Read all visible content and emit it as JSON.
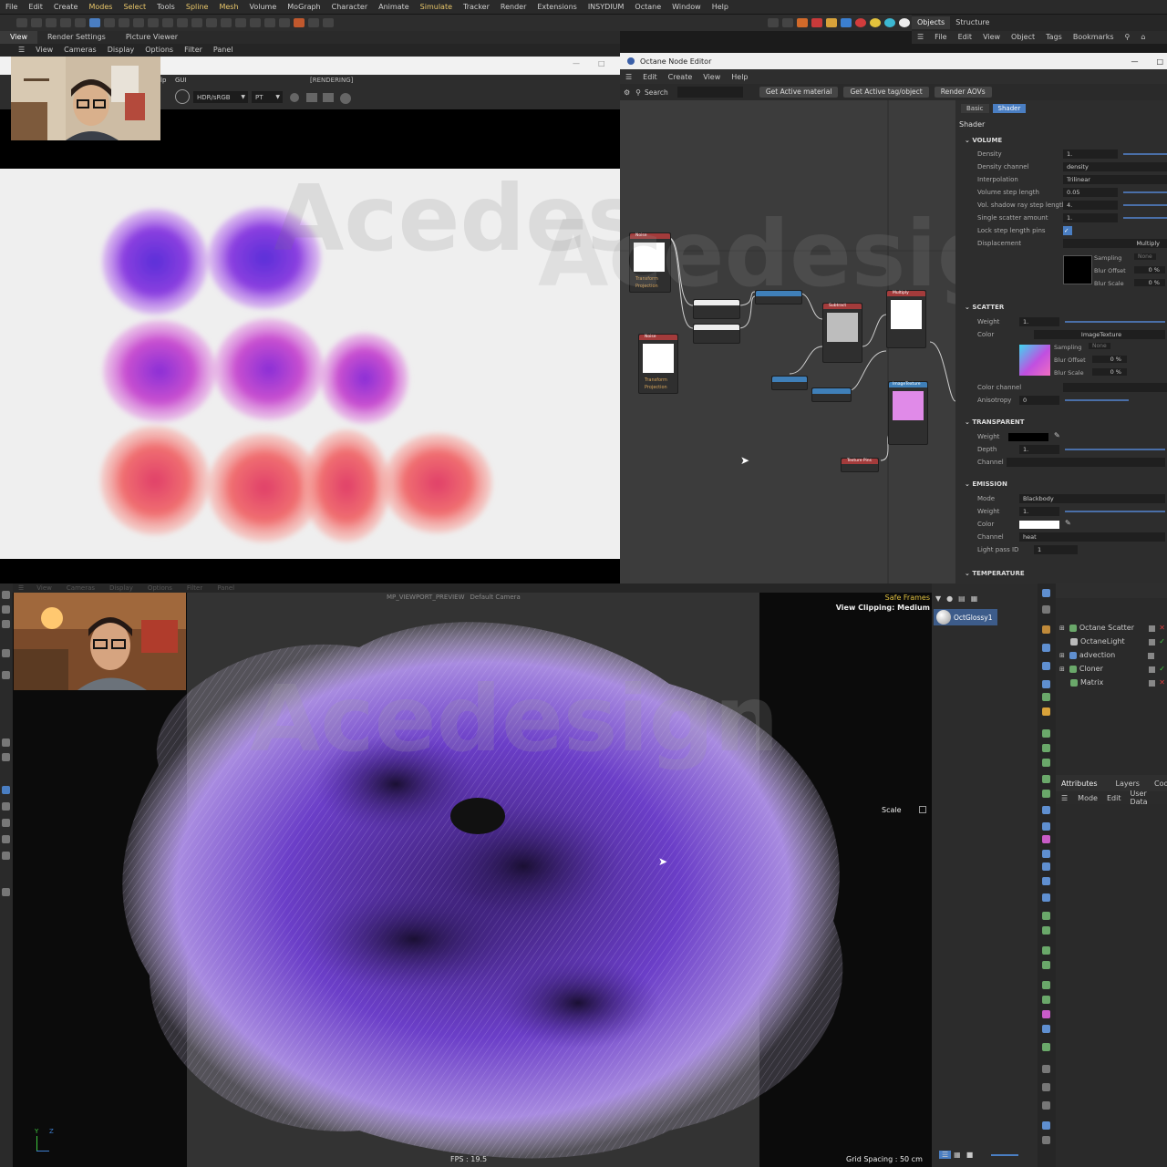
{
  "menubar": [
    "File",
    "Edit",
    "Create",
    "Modes",
    "Select",
    "Tools",
    "Spline",
    "Mesh",
    "Volume",
    "MoGraph",
    "Character",
    "Animate",
    "Simulate",
    "Tracker",
    "Render",
    "Extensions",
    "INSYDIUM",
    "Octane",
    "Window",
    "Help"
  ],
  "menubar_highlight": [
    "Modes",
    "Select",
    "Spline",
    "Mesh",
    "Simulate"
  ],
  "objects_tabs": [
    "Objects",
    "Structure"
  ],
  "objects_menu": [
    "File",
    "Edit",
    "View",
    "Object",
    "Tags",
    "Bookmarks"
  ],
  "viewport_tabs": [
    "View",
    "Render Settings",
    "Picture Viewer"
  ],
  "viewport_menu": [
    "View",
    "Cameras",
    "Display",
    "Options",
    "Filter",
    "Panel"
  ],
  "picture_viewer": {
    "menu": [
      "lp",
      "GUI"
    ],
    "status": "[RENDERING]",
    "color_space": "HDR/sRGB",
    "kernel": "PT"
  },
  "watermark": "Acedesign",
  "node_editor": {
    "title": "Octane Node Editor",
    "menu": [
      "Edit",
      "Create",
      "View",
      "Help"
    ],
    "search_label": "Search",
    "buttons": [
      "Get Active material",
      "Get Active tag/object",
      "Render AOVs"
    ],
    "nodes": {
      "noise1": "Noise",
      "noise2": "Noise",
      "subtract": "Subtract",
      "multiply": "Multiply",
      "image_texture": "ImageTexture",
      "texture_pins": "Texture Pins"
    }
  },
  "attributes": {
    "tabs": [
      "Basic",
      "Shader"
    ],
    "active_tab": "Shader",
    "heading": "Shader",
    "volume": {
      "title": "VOLUME",
      "rows": [
        {
          "label": "Density",
          "value": "1."
        },
        {
          "label": "Density channel",
          "value": "density"
        },
        {
          "label": "Interpolation",
          "value": "Trilinear"
        },
        {
          "label": "Volume step length",
          "value": "0.05"
        },
        {
          "label": "Vol. shadow ray step length",
          "value": "4."
        },
        {
          "label": "Single scatter amount",
          "value": "1."
        },
        {
          "label": "Lock step length pins",
          "value": "✓"
        },
        {
          "label": "Displacement",
          "value": "Multiply"
        }
      ],
      "sampling_label": "Sampling",
      "sampling_value": "None",
      "blur_offset_label": "Blur Offset",
      "blur_offset": "0 %",
      "blur_scale_label": "Blur Scale",
      "blur_scale": "0 %"
    },
    "scatter": {
      "title": "SCATTER",
      "weight_label": "Weight",
      "weight": "1.",
      "color_label": "Color",
      "color_value": "ImageTexture",
      "sampling_label": "Sampling",
      "sampling_value": "None",
      "blur_offset_label": "Blur Offset",
      "blur_offset": "0 %",
      "blur_scale_label": "Blur Scale",
      "blur_scale": "0 %",
      "color_channel_label": "Color channel",
      "anisotropy_label": "Anisotropy",
      "anisotropy": "0"
    },
    "transparent": {
      "title": "TRANSPARENT",
      "weight_label": "Weight",
      "depth_label": "Depth",
      "depth": "1.",
      "channel_label": "Channel"
    },
    "emission": {
      "title": "EMISSION",
      "mode_label": "Mode",
      "mode": "Blackbody",
      "weight_label": "Weight",
      "weight": "1.",
      "color_label": "Color",
      "channel_label": "Channel",
      "channel": "heat",
      "light_pass_label": "Light pass ID",
      "light_pass": "1"
    },
    "temperature": {
      "title": "TEMPERATURE"
    }
  },
  "viewport3d": {
    "menu": [
      "View",
      "Cameras",
      "Display",
      "Options",
      "Filter",
      "Panel"
    ],
    "label": "MP_VIEWPORT_PREVIEW",
    "camera": "Default Camera",
    "safe_frames": "Safe Frames",
    "view_clipping": "View Clipping: Medium",
    "scale": "Scale",
    "fps": "FPS : 19.5",
    "grid_spacing": "Grid Spacing : 50 cm",
    "axis_y": "Y",
    "axis_z": "Z"
  },
  "material": "OctGlossy1",
  "objects": [
    {
      "name": "Octane Scatter",
      "status": "✕"
    },
    {
      "name": "OctaneLight",
      "status": "✓"
    },
    {
      "name": "advection",
      "status": ""
    },
    {
      "name": "Cloner",
      "status": "✓"
    },
    {
      "name": "Matrix",
      "status": "✕"
    }
  ],
  "attr_manager": {
    "tabs": [
      "Attributes",
      "Layers",
      "Coor"
    ],
    "menu": [
      "Mode",
      "Edit",
      "User Data"
    ]
  },
  "colors": {
    "accent": "#4a7ec2",
    "node_red": "#a33b3b",
    "node_blue": "#3f7fb8",
    "purple": "#7a3fd6",
    "pink": "#e15a8c",
    "orange": "#f07a5a",
    "status_green": "#3ec83e",
    "status_red": "#d23c3c"
  }
}
